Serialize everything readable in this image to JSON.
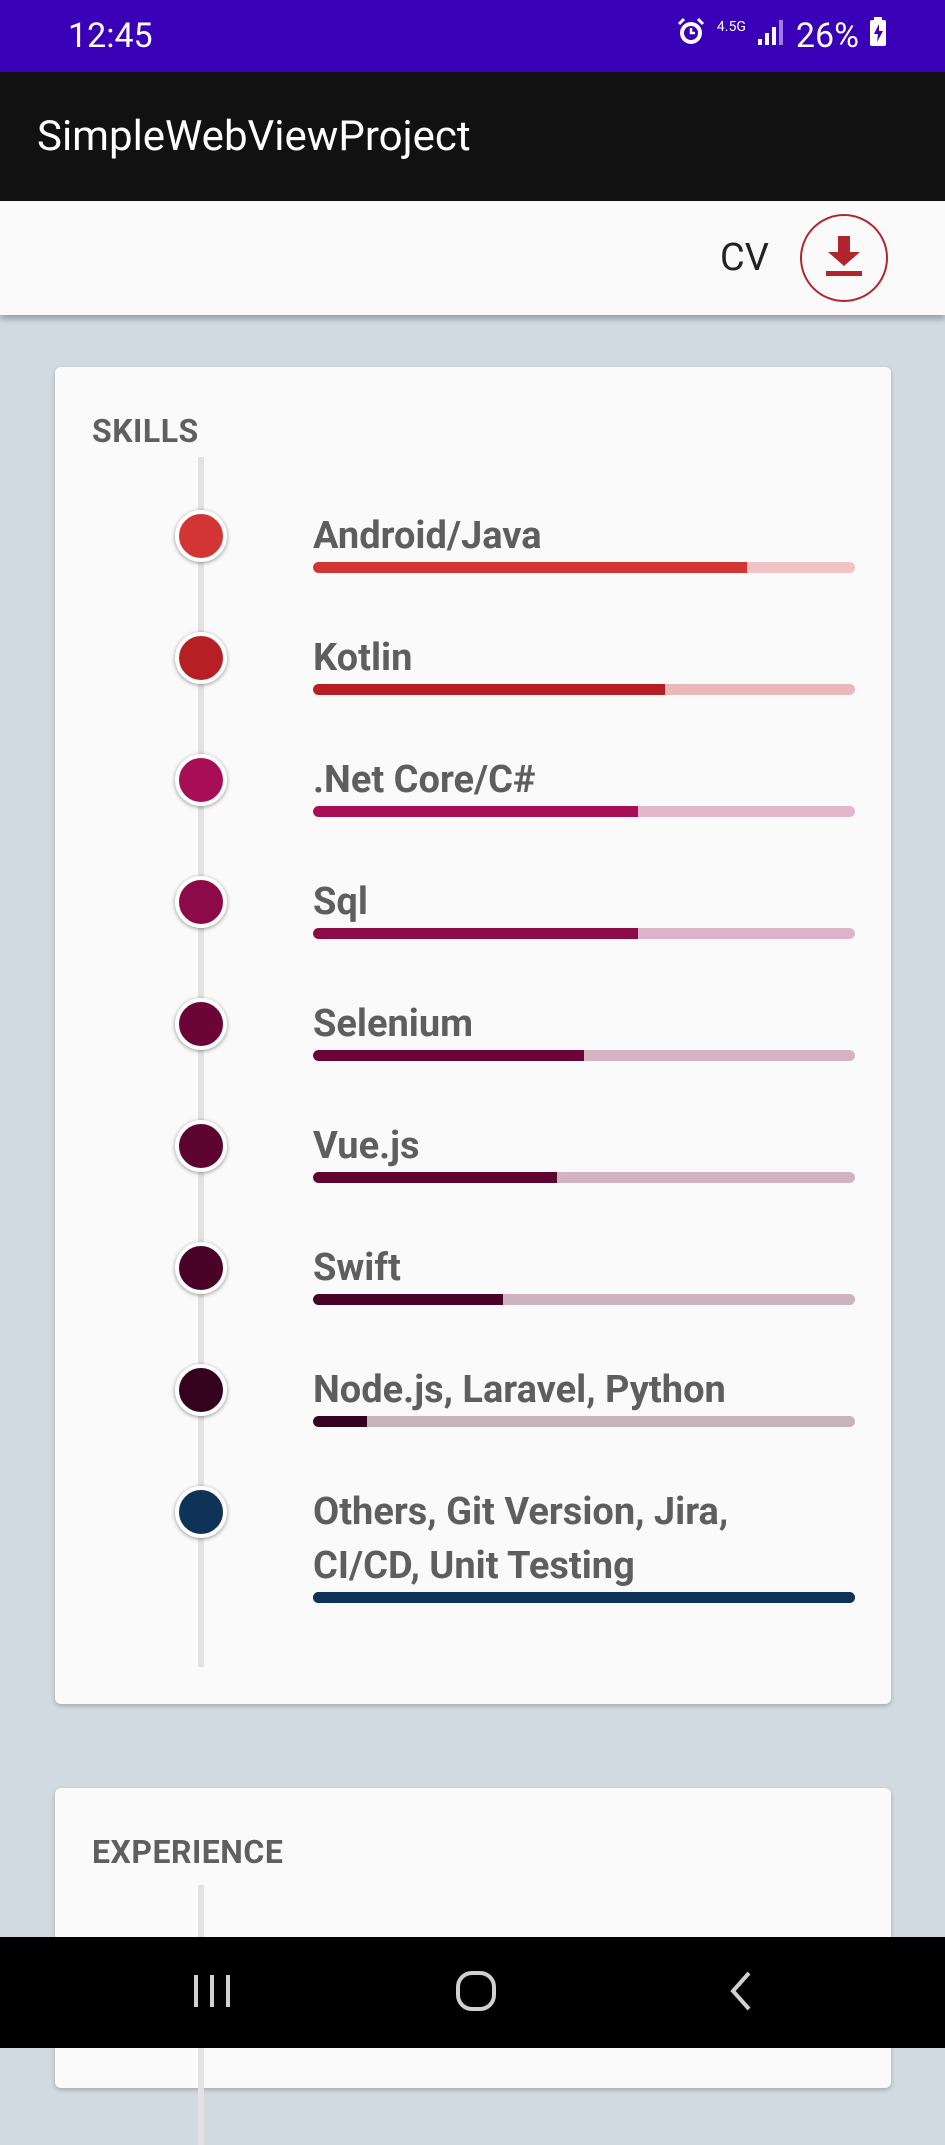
{
  "status": {
    "time": "12:45",
    "network": "4.5G",
    "battery": "26%"
  },
  "app": {
    "title": "SimpleWebViewProject"
  },
  "toolbar": {
    "cv_label": "CV"
  },
  "skills_card": {
    "title": "SKILLS",
    "items": [
      {
        "name": "Android/Java",
        "level": 0.8,
        "color": "#d23533",
        "track": "#f2c3c4"
      },
      {
        "name": "Kotlin",
        "level": 0.65,
        "color": "#b62024",
        "track": "#e8b8ba"
      },
      {
        "name": ".Net Core/C#",
        "level": 0.6,
        "color": "#a80e56",
        "track": "#e4b6cb"
      },
      {
        "name": "Sql",
        "level": 0.6,
        "color": "#8c0a48",
        "track": "#ddb4c7"
      },
      {
        "name": "Selenium",
        "level": 0.5,
        "color": "#6c0535",
        "track": "#d5b3c2"
      },
      {
        "name": "Vue.js",
        "level": 0.45,
        "color": "#5d0530",
        "track": "#d1b3c1"
      },
      {
        "name": "Swift",
        "level": 0.35,
        "color": "#4a0328",
        "track": "#ccb3be"
      },
      {
        "name": "Node.js, Laravel, Python",
        "level": 0.1,
        "color": "#34021e",
        "track": "#c7b3ba"
      },
      {
        "name": "Others, Git Version, Jira, CI/CD, Unit Testing",
        "level": 1.0,
        "color": "#0f3358",
        "track": "#0f3358"
      }
    ]
  },
  "experience_card": {
    "title": "EXPERIENCE"
  },
  "icons": {
    "alarm": "alarm-icon",
    "signal": "signal-icon",
    "battery": "battery-icon",
    "download": "download-icon",
    "recents": "recents-icon",
    "home": "home-icon",
    "back": "back-icon"
  }
}
